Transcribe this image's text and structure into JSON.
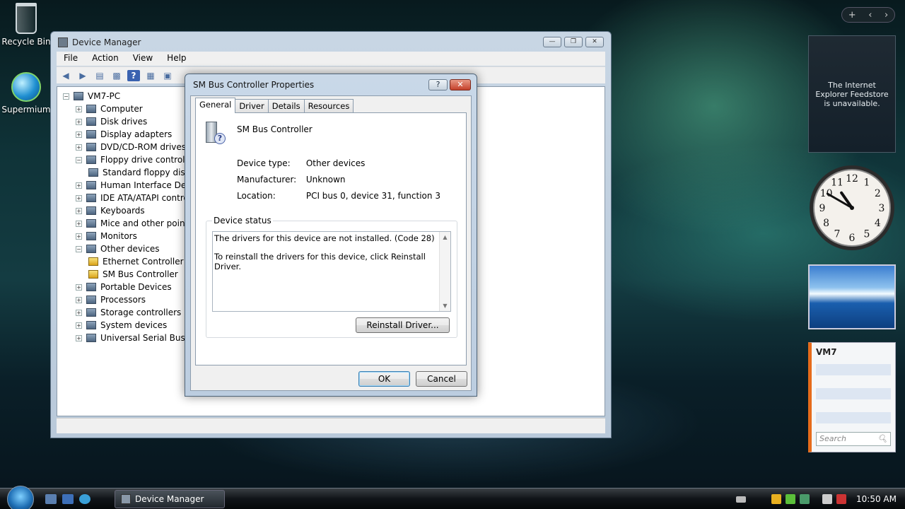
{
  "desktop": {
    "icons": [
      {
        "label": "Recycle Bin"
      },
      {
        "label": "Supermium"
      }
    ]
  },
  "sidebar": {
    "controls": [
      "+",
      "‹",
      "›"
    ],
    "feed_gadget_text": "The Internet Explorer Feedstore is unavailable.",
    "clock": {
      "hour": 10,
      "minute": 50,
      "numbers": [
        "12",
        "1",
        "2",
        "3",
        "4",
        "5",
        "6",
        "7",
        "8",
        "9",
        "10",
        "11"
      ]
    },
    "contacts": {
      "title": "VM7",
      "search_placeholder": "Search"
    }
  },
  "device_manager": {
    "title": "Device Manager",
    "window_buttons": [
      "—",
      "❐",
      "✕"
    ],
    "menu": [
      "File",
      "Action",
      "View",
      "Help"
    ],
    "toolbar_icons": [
      "back-icon",
      "forward-icon",
      "show-hide-icon",
      "properties-icon",
      "help-icon",
      "view-icon",
      "scan-icon"
    ],
    "tree": {
      "root": "VM7-PC",
      "items": [
        {
          "label": "Computer",
          "expanded": false
        },
        {
          "label": "Disk drives",
          "expanded": false
        },
        {
          "label": "Display adapters",
          "expanded": false
        },
        {
          "label": "DVD/CD-ROM drives",
          "expanded": false
        },
        {
          "label": "Floppy drive controllers",
          "expanded": true
        },
        {
          "label": "Standard floppy disk controller",
          "child": true
        },
        {
          "label": "Human Interface Devices",
          "expanded": false
        },
        {
          "label": "IDE ATA/ATAPI controllers",
          "expanded": false
        },
        {
          "label": "Keyboards",
          "expanded": false
        },
        {
          "label": "Mice and other pointing devices",
          "expanded": false
        },
        {
          "label": "Monitors",
          "expanded": false
        },
        {
          "label": "Other devices",
          "expanded": true
        },
        {
          "label": "Ethernet Controller",
          "child": true,
          "warning": true
        },
        {
          "label": "SM Bus Controller",
          "child": true,
          "warning": true
        },
        {
          "label": "Portable Devices",
          "expanded": false
        },
        {
          "label": "Processors",
          "expanded": false
        },
        {
          "label": "Storage controllers",
          "expanded": false
        },
        {
          "label": "System devices",
          "expanded": false
        },
        {
          "label": "Universal Serial Bus controllers",
          "expanded": false
        }
      ]
    }
  },
  "properties_dialog": {
    "title": "SM Bus Controller Properties",
    "help_button": "?",
    "close_button": "✕",
    "tabs": [
      "General",
      "Driver",
      "Details",
      "Resources"
    ],
    "active_tab": "General",
    "device_name": "SM Bus Controller",
    "device_type_label": "Device type:",
    "device_type_value": "Other devices",
    "manufacturer_label": "Manufacturer:",
    "manufacturer_value": "Unknown",
    "location_label": "Location:",
    "location_value": "PCI bus 0, device 31, function 3",
    "status_group_label": "Device status",
    "status_line1": "The drivers for this device are not installed. (Code 28)",
    "status_line2": "To reinstall the drivers for this device, click Reinstall Driver.",
    "reinstall_button": "Reinstall Driver...",
    "ok_button": "OK",
    "cancel_button": "Cancel"
  },
  "taskbar": {
    "task_button": "Device Manager",
    "clock": "10:50 AM"
  }
}
